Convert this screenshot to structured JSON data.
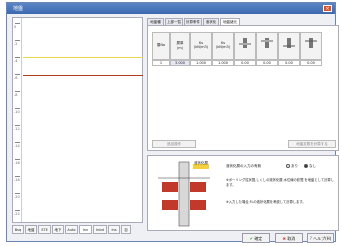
{
  "window": {
    "title": "地盤"
  },
  "graph": {
    "tick_labels": [
      "0",
      "-2",
      "-4",
      "-6",
      "-8",
      "-10",
      "-12",
      "-14",
      "-16",
      "-18",
      "-20",
      "-22"
    ]
  },
  "bottom_tabs": [
    "Bsq",
    "地盤",
    "STE",
    "地下",
    "Auto",
    "Inn",
    "Inbd",
    "Ins",
    "自"
  ],
  "right_tabs": [
    "地盤種",
    "上部一覧",
    "計算条件",
    "液状化",
    "地盤諸元"
  ],
  "table": {
    "headers": [
      "層No",
      "層厚",
      "Ks",
      "Ks",
      "",
      "",
      "",
      ""
    ],
    "subheaders": [
      "",
      "(m)",
      "(kN/m3)",
      "(kN/m3)",
      "",
      "",
      "",
      ""
    ],
    "row": [
      "1",
      "3.000",
      "1.000",
      "1.000",
      "0.00",
      "0.00",
      "0.00",
      "0.00"
    ]
  },
  "buttons": {
    "add": "追加操作",
    "calc": "地盤定数を計算する",
    "ok": "確定",
    "cancel": "取消",
    "help": "ヘルプ(H)"
  },
  "lower": {
    "legend_label": "液状化層",
    "option_label": "液状化層の入力の有無",
    "radio_yes": "あり",
    "radio_no": "なし",
    "note1": "※ボーリング柱状図,しくしの液状化層,水位線の影響,を地盤として計算します。",
    "note2": "※入力した場合,FLの液状化層を考慮して計算します。"
  }
}
